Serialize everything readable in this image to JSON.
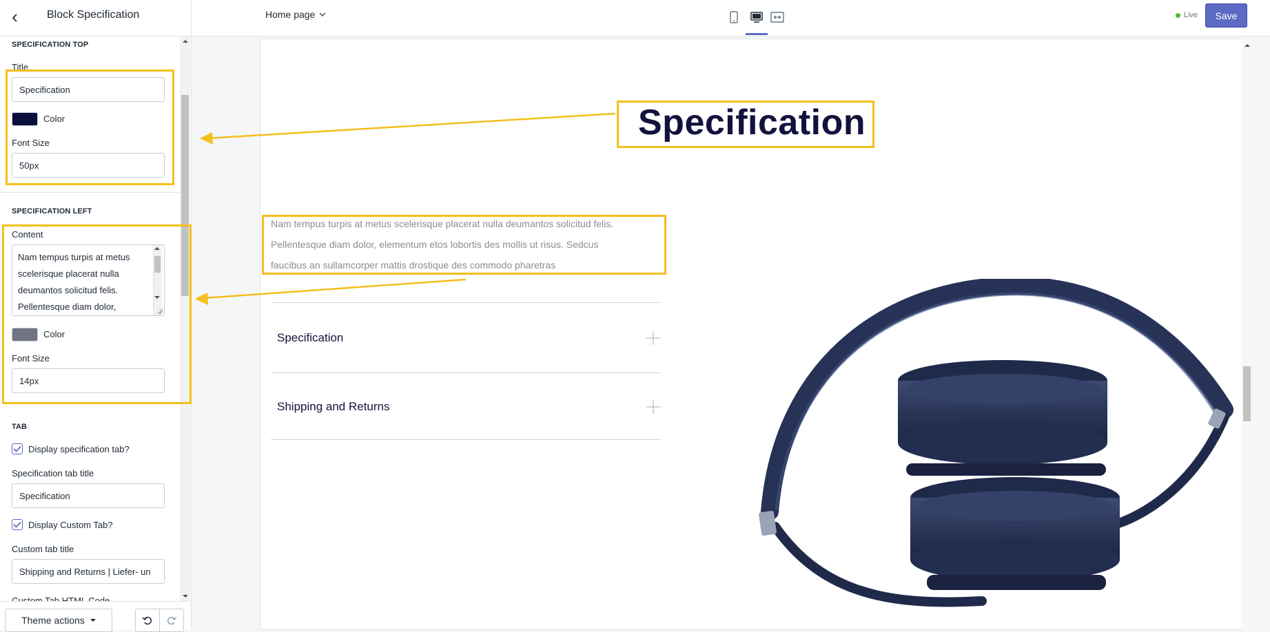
{
  "header": {
    "panel_title": "Block Specification",
    "page_selector": "Home page",
    "live_label": "Live",
    "save_label": "Save"
  },
  "sidebar": {
    "spec_top": {
      "heading": "SPECIFICATION TOP",
      "title_label": "Title",
      "title_value": "Specification",
      "color_label": "Color",
      "color_value": "#0b0f3d",
      "font_size_label": "Font Size",
      "font_size_value": "50px"
    },
    "spec_left": {
      "heading": "SPECIFICATION LEFT",
      "content_label": "Content",
      "content_lines": [
        "Nam tempus turpis at metus",
        "scelerisque placerat nulla",
        "deumantos solicitud felis.",
        "Pellentesque diam dolor,"
      ],
      "color_label": "Color",
      "color_value": "#717584",
      "font_size_label": "Font Size",
      "font_size_value": "14px"
    },
    "tab": {
      "heading": "TAB",
      "display_spec_label": "Display specification tab?",
      "display_spec_checked": true,
      "spec_title_label": "Specification tab title",
      "spec_title_value": "Specification",
      "display_custom_label": "Display Custom Tab?",
      "display_custom_checked": true,
      "custom_title_label": "Custom tab title",
      "custom_title_value": "Shipping and Returns | Liefer- un",
      "custom_html_label": "Custom Tab HTML Code"
    },
    "footer": {
      "theme_actions_label": "Theme actions"
    }
  },
  "preview": {
    "title": "Specification",
    "body_lines": [
      "Nam tempus turpis at metus scelerisque placerat nulla deumantos solicitud felis.",
      "Pellentesque diam dolor, elementum etos lobortis des mollis ut risus. Sedcus",
      "faucibus an sullamcorper mattis drostique des commodo pharetras"
    ],
    "tabs": [
      "Specification",
      "Shipping and Returns"
    ]
  },
  "colors": {
    "accent": "#5c6ac4",
    "annotation": "#f4be1c",
    "headphone": "#2d3a5c"
  },
  "icons": [
    "back-arrow-icon",
    "chevron-down-icon",
    "mobile-icon",
    "desktop-icon",
    "fullscreen-icon",
    "checkmark-icon",
    "plus-icon",
    "undo-icon",
    "redo-icon",
    "caret-down-icon"
  ]
}
